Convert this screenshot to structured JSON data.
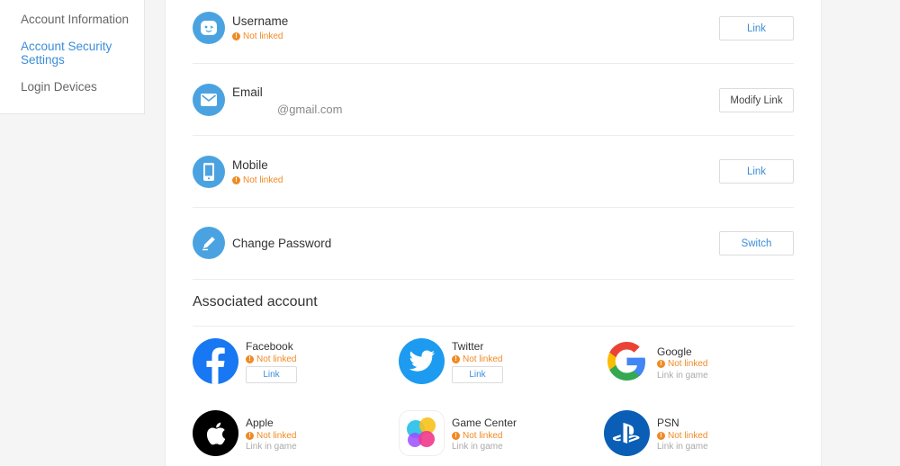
{
  "sidebar": {
    "items": [
      {
        "label": "Account Information"
      },
      {
        "label": "Account Security Settings"
      },
      {
        "label": "Login Devices"
      }
    ]
  },
  "security": {
    "username": {
      "title": "Username",
      "status": "Not linked",
      "button": "Link",
      "icon": "face-icon"
    },
    "email": {
      "title": "Email",
      "value": "@gmail.com",
      "button": "Modify Link",
      "icon": "envelope-icon"
    },
    "mobile": {
      "title": "Mobile",
      "status": "Not linked",
      "button": "Link",
      "icon": "phone-icon"
    },
    "password": {
      "title": "Change Password",
      "button": "Switch",
      "icon": "pencil-icon"
    }
  },
  "associated": {
    "title": "Associated account",
    "accounts": [
      {
        "name": "Facebook",
        "status": "Not linked",
        "button": "Link",
        "icon": "facebook-icon"
      },
      {
        "name": "Twitter",
        "status": "Not linked",
        "button": "Link",
        "icon": "twitter-icon"
      },
      {
        "name": "Google",
        "status": "Not linked",
        "sub": "Link in game",
        "icon": "google-icon"
      },
      {
        "name": "Apple",
        "status": "Not linked",
        "sub": "Link in game",
        "icon": "apple-icon"
      },
      {
        "name": "Game Center",
        "status": "Not linked",
        "sub": "Link in game",
        "icon": "game-center-icon"
      },
      {
        "name": "PSN",
        "status": "Not linked",
        "sub": "Link in game",
        "icon": "playstation-icon"
      }
    ]
  },
  "colors": {
    "accent": "#3b8dd9",
    "warning": "#f08a24",
    "icon_bg": "#4aa3e0",
    "facebook": "#1877f2",
    "twitter": "#1d9bf0",
    "psn": "#0a5eb6"
  }
}
